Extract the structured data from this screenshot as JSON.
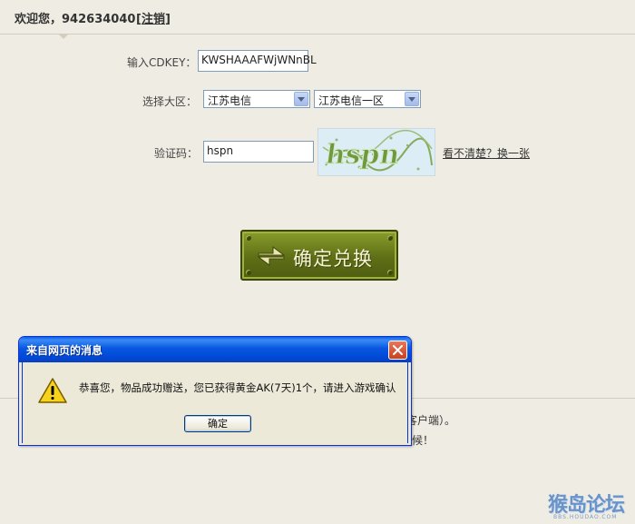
{
  "header": {
    "welcome_label": "欢迎您，",
    "user_id": "942634040",
    "logout_open": "[",
    "logout_label": "注销",
    "logout_close": "]"
  },
  "form": {
    "cdkey_label": "输入CDKEY：",
    "cdkey_value": "KWSHAAAFWjWNnBL",
    "server_label": "选择大区：",
    "region_value": "江苏电信",
    "server_value": "江苏电信一区",
    "captcha_label": "验证码：",
    "captcha_value": "hspn",
    "captcha_image_text": "hspn",
    "refresh_link": "看不清楚？换一张"
  },
  "confirm_button": {
    "label": "确定兑换",
    "color": "#6b7c1d"
  },
  "background_fragments": {
    "line1": "客户端）。",
    "line2": "候！"
  },
  "dialog": {
    "title": "来自网页的消息",
    "message": "恭喜您，物品成功赠送，您已获得黄金AK(7天)1个，请进入游戏确认",
    "ok_label": "确定",
    "icon": "warning-icon",
    "title_color": "#0857e1"
  },
  "watermark": {
    "text": "猴岛论坛",
    "sub": "BBS.HOUDAO.COM"
  }
}
